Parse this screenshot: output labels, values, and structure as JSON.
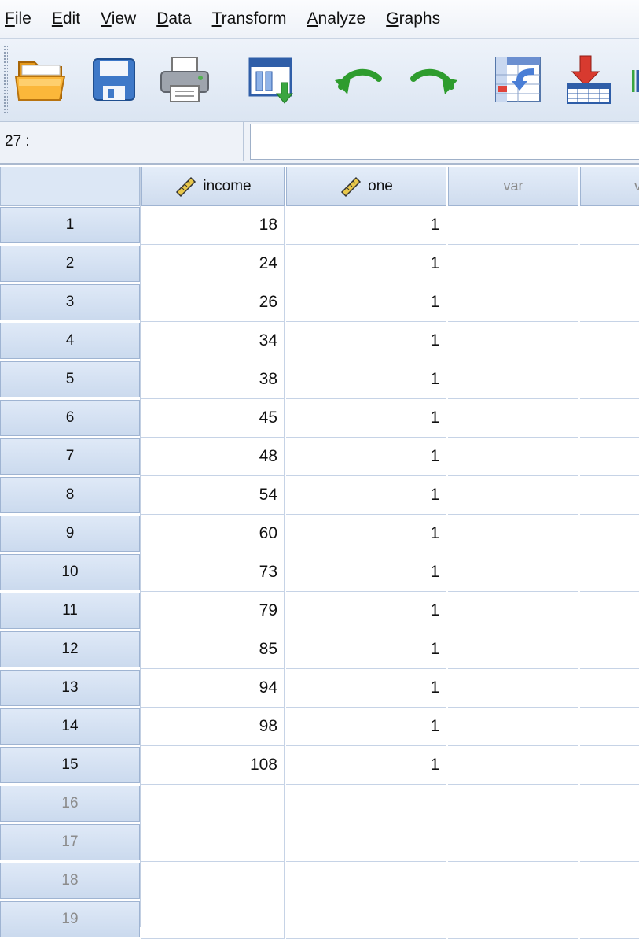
{
  "menu": [
    {
      "mnemonic": "F",
      "rest": "ile"
    },
    {
      "mnemonic": "E",
      "rest": "dit"
    },
    {
      "mnemonic": "V",
      "rest": "iew"
    },
    {
      "mnemonic": "D",
      "rest": "ata"
    },
    {
      "mnemonic": "T",
      "rest": "ransform"
    },
    {
      "mnemonic": "A",
      "rest": "nalyze"
    },
    {
      "mnemonic": "G",
      "rest": "raphs"
    }
  ],
  "toolbar": {
    "icons": [
      "open-folder-icon",
      "save-icon",
      "print-icon",
      "recall-dialog-icon",
      "undo-icon",
      "redo-icon",
      "goto-case-icon",
      "goto-variable-icon"
    ]
  },
  "cell_ref": {
    "label": "27 :",
    "value": ""
  },
  "grid": {
    "columns": [
      {
        "name": "income",
        "icon": "scale-ruler-icon",
        "empty": false
      },
      {
        "name": "one",
        "icon": "scale-ruler-icon",
        "empty": false
      },
      {
        "name": "var",
        "icon": "",
        "empty": true
      },
      {
        "name": "v",
        "icon": "",
        "empty": true
      }
    ],
    "rows": [
      {
        "n": "1",
        "income": "18",
        "one": "1"
      },
      {
        "n": "2",
        "income": "24",
        "one": "1"
      },
      {
        "n": "3",
        "income": "26",
        "one": "1"
      },
      {
        "n": "4",
        "income": "34",
        "one": "1"
      },
      {
        "n": "5",
        "income": "38",
        "one": "1"
      },
      {
        "n": "6",
        "income": "45",
        "one": "1"
      },
      {
        "n": "7",
        "income": "48",
        "one": "1"
      },
      {
        "n": "8",
        "income": "54",
        "one": "1"
      },
      {
        "n": "9",
        "income": "60",
        "one": "1"
      },
      {
        "n": "10",
        "income": "73",
        "one": "1"
      },
      {
        "n": "11",
        "income": "79",
        "one": "1"
      },
      {
        "n": "12",
        "income": "85",
        "one": "1"
      },
      {
        "n": "13",
        "income": "94",
        "one": "1"
      },
      {
        "n": "14",
        "income": "98",
        "one": "1"
      },
      {
        "n": "15",
        "income": "108",
        "one": "1"
      }
    ],
    "empty_rows": [
      "16",
      "17",
      "18",
      "19"
    ]
  },
  "colors": {
    "accent": "#d4e2f4",
    "header_border": "#9fb4d2"
  }
}
